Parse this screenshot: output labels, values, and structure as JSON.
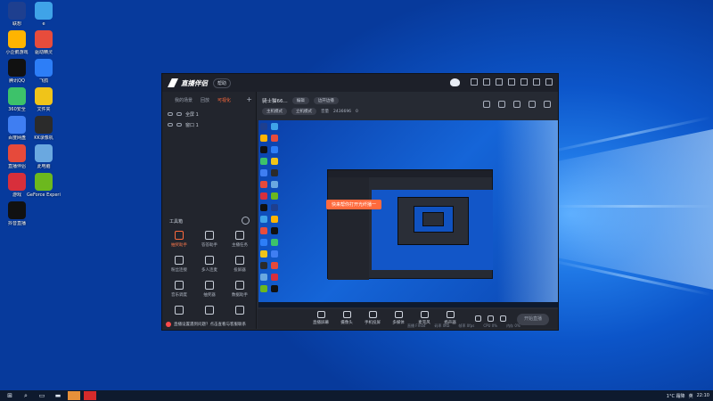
{
  "desktop": {
    "icons": [
      {
        "label": "联想",
        "sub": "2436696",
        "color": "#1e3f8f"
      },
      {
        "label": "e",
        "color": "#3fa3e8"
      },
      {
        "label": "小企鹅游戏",
        "color": "#ffb400"
      },
      {
        "label": "驱动精灵",
        "color": "#e74c3c"
      },
      {
        "label": "腾讯QQ",
        "color": "#111111"
      },
      {
        "label": "飞鸽",
        "color": "#2d7ef7"
      },
      {
        "label": "360安全",
        "color": "#3dc26a"
      },
      {
        "label": "文件夹",
        "color": "#f0c419"
      },
      {
        "label": "百度网盘",
        "color": "#3f7ef2"
      },
      {
        "label": "KK录像机",
        "color": "#2b2b2b"
      },
      {
        "label": "直播伴侣",
        "color": "#e64a3b"
      },
      {
        "label": "此电脑",
        "color": "#6aa8e0"
      },
      {
        "label": "游戏",
        "color": "#d82f3b"
      },
      {
        "label": "GeForce Experience",
        "color": "#6cb81e"
      },
      {
        "label": "抖音直播",
        "color": "#111111"
      }
    ]
  },
  "taskbar": {
    "clock": "22:10",
    "lang": "英",
    "weather": "1°C 霜降"
  },
  "app": {
    "title": "直播伴侣",
    "version_btn": "帮助",
    "left_tabs": [
      "我的场景",
      "回放",
      "可视化"
    ],
    "scenes": [
      "全屏 1",
      "窗口 1"
    ],
    "tools_title": "工具箱",
    "tools": [
      {
        "label": "抽奖助手",
        "hot": true
      },
      {
        "label": "答答助手",
        "hot": false
      },
      {
        "label": "主播任务",
        "hot": false
      },
      {
        "label": "粉丝连接",
        "hot": false
      },
      {
        "label": "多人连麦",
        "hot": false
      },
      {
        "label": "投屏器",
        "hot": false
      },
      {
        "label": "音乐调度",
        "hot": false
      },
      {
        "label": "抽奖器",
        "hot": false
      },
      {
        "label": "数据助手",
        "hot": false
      },
      {
        "label": "",
        "hot": false
      },
      {
        "label": "",
        "hot": false
      },
      {
        "label": "",
        "hot": false
      }
    ],
    "footer_note": "直播设置遇到问题？点击查看与客服联系",
    "room_title": "骑士猫66...",
    "room_pill": "编辑",
    "room_pill2": "边开边播",
    "mode_pill": "主机模式",
    "mode_pill2": "立机模式",
    "stat_label": "音量",
    "stat_value": "2436696",
    "stat_extra": "0",
    "tooltip": "快来帮你打开光纤播一",
    "controls": [
      "直播屏幕",
      "摄像头",
      "手机投屏",
      "多媒体",
      "麦克风",
      "扬声器"
    ],
    "go_live": "开始直播",
    "status_items": [
      "直播 Fmod",
      "码率 0Kb",
      "帧率 0fps",
      "CPU 0%",
      "内存 0%"
    ]
  }
}
